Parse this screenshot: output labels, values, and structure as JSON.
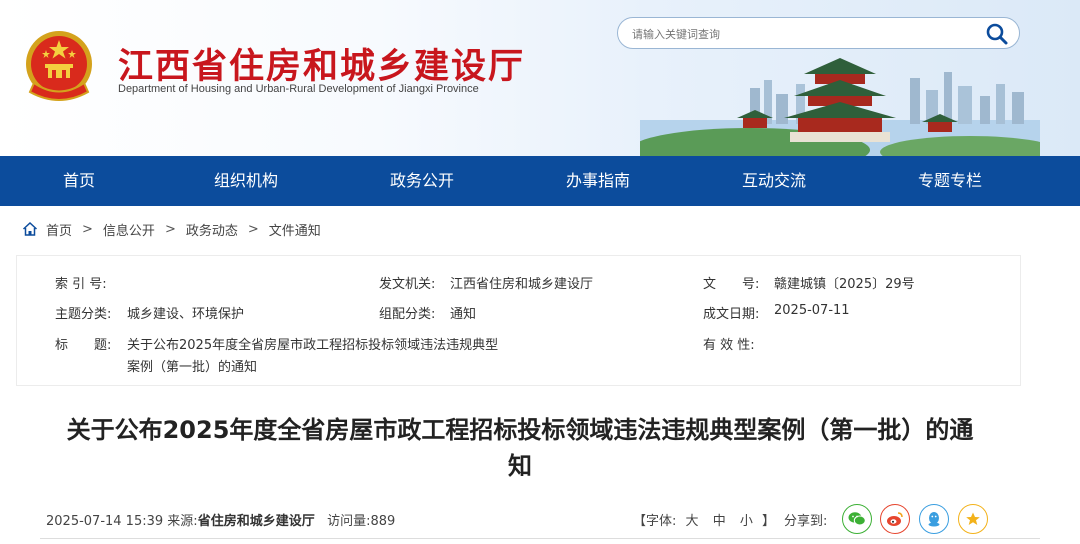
{
  "header": {
    "title": "江西省住房和城乡建设厅",
    "subtitle": "Department of Housing and Urban-Rural Development of Jiangxi Province",
    "search_placeholder": "请输入关键词查询"
  },
  "nav": {
    "items": [
      {
        "label": "首页"
      },
      {
        "label": "组织机构"
      },
      {
        "label": "政务公开"
      },
      {
        "label": "办事指南"
      },
      {
        "label": "互动交流"
      },
      {
        "label": "专题专栏"
      }
    ]
  },
  "breadcrumb": {
    "items": [
      "首页",
      "信息公开",
      "政务动态",
      "文件通知"
    ],
    "separator": ">"
  },
  "meta": {
    "index_label": "索 引 号:",
    "index_value": "",
    "issuer_label": "发文机关:",
    "issuer_value": "江西省住房和城乡建设厅",
    "docno_label": "文　　号:",
    "docno_value": "赣建城镇〔2025〕29号",
    "topic_label": "主题分类:",
    "topic_value": "城乡建设、环境保护",
    "category_label": "组配分类:",
    "category_value": "通知",
    "date_label": "成文日期:",
    "date_value": "2025-07-11",
    "title_label": "标　　题:",
    "title_value_line1": "关于公布2025年度全省房屋市政工程招标投标领域违法违规典型",
    "title_value_line2": "案例（第一批）的通知",
    "validity_label": "有 效 性:",
    "validity_value": ""
  },
  "article": {
    "title_line1": "关于公布2025年度全省房屋市政工程招标投标领域违法违规典型案例（第一批）的通",
    "title_line2": "知",
    "publish_time": "2025-07-14 15:39",
    "source_label": "来源:",
    "source_value": "省住房和城乡建设厅",
    "views_label": "访问量:",
    "views_value": "889",
    "font_label_open": "【字体:",
    "font_large": "大",
    "font_medium": "中",
    "font_small": "小",
    "font_label_close": "】",
    "share_label": "分享到:"
  },
  "colors": {
    "brand_red": "#c8161d",
    "nav_blue": "#0c4c9c",
    "wechat_green": "#3cb035",
    "weibo_red": "#e6452e",
    "qq_blue": "#3a9ee0",
    "favorite_yellow": "#f3b21a"
  },
  "icons": [
    "national-emblem-icon",
    "search-icon",
    "home-icon",
    "wechat-icon",
    "weibo-icon",
    "qq-icon",
    "favorite-icon"
  ]
}
